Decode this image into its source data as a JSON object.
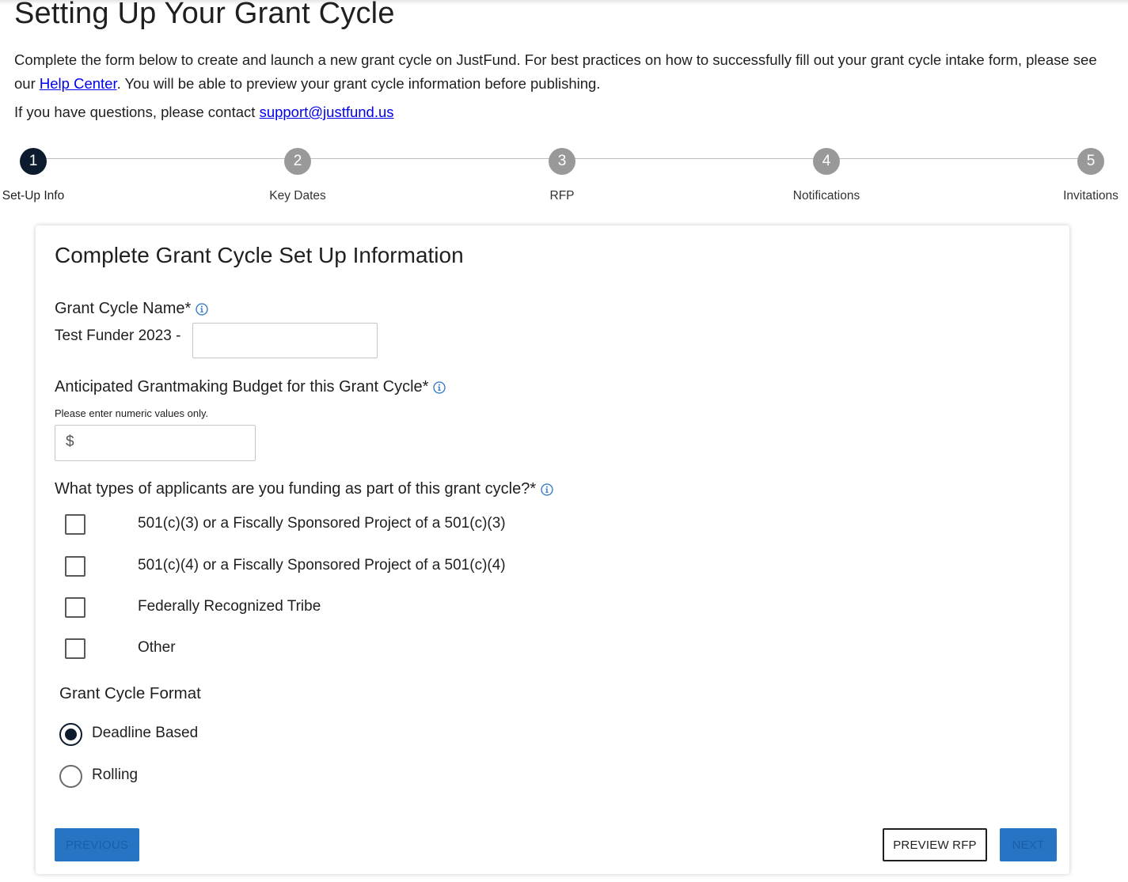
{
  "header": {
    "title": "Setting Up Your Grant Cycle",
    "intro_before_link": "Complete the form below to create and launch a new grant cycle on JustFund. For best practices on how to successfully fill out your grant cycle intake form, please see our ",
    "help_link_label": "Help Center",
    "intro_after_link": ". You will be able to preview your grant cycle information before publishing.",
    "contact_text": "If you have questions, please contact ",
    "contact_email": "support@justfund.us"
  },
  "stepper": {
    "steps": [
      {
        "number": "1",
        "label": "Set-Up Info",
        "active": true
      },
      {
        "number": "2",
        "label": "Key Dates",
        "active": false
      },
      {
        "number": "3",
        "label": "RFP",
        "active": false
      },
      {
        "number": "4",
        "label": "Notifications",
        "active": false
      },
      {
        "number": "5",
        "label": "Invitations",
        "active": false
      }
    ]
  },
  "form": {
    "title": "Complete Grant Cycle Set Up Information",
    "cycle_name": {
      "label": "Grant Cycle Name*",
      "prefix": "Test Funder 2023 -",
      "value": ""
    },
    "budget": {
      "label": "Anticipated Grantmaking Budget for this Grant Cycle*",
      "hint": "Please enter numeric values only.",
      "currency_prefix": "$",
      "value": ""
    },
    "applicant_types": {
      "label": "What types of applicants are you funding as part of this grant cycle?*",
      "options": [
        {
          "label": "501(c)(3) or a Fiscally Sponsored Project of a 501(c)(3)",
          "checked": false
        },
        {
          "label": "501(c)(4) or a Fiscally Sponsored Project of a 501(c)(4)",
          "checked": false
        },
        {
          "label": "Federally Recognized Tribe",
          "checked": false
        },
        {
          "label": "Other",
          "checked": false
        }
      ]
    },
    "format": {
      "label": "Grant Cycle Format",
      "options": [
        {
          "label": "Deadline Based",
          "selected": true
        },
        {
          "label": "Rolling",
          "selected": false
        }
      ]
    },
    "buttons": {
      "previous": "Previous",
      "preview": "Preview RFP",
      "next": "Next"
    }
  },
  "colors": {
    "active_step": "#0d1b2e",
    "inactive_step": "#999999",
    "primary_button": "#2874c4",
    "link": "#0000ee",
    "info_icon": "#2874c4"
  }
}
